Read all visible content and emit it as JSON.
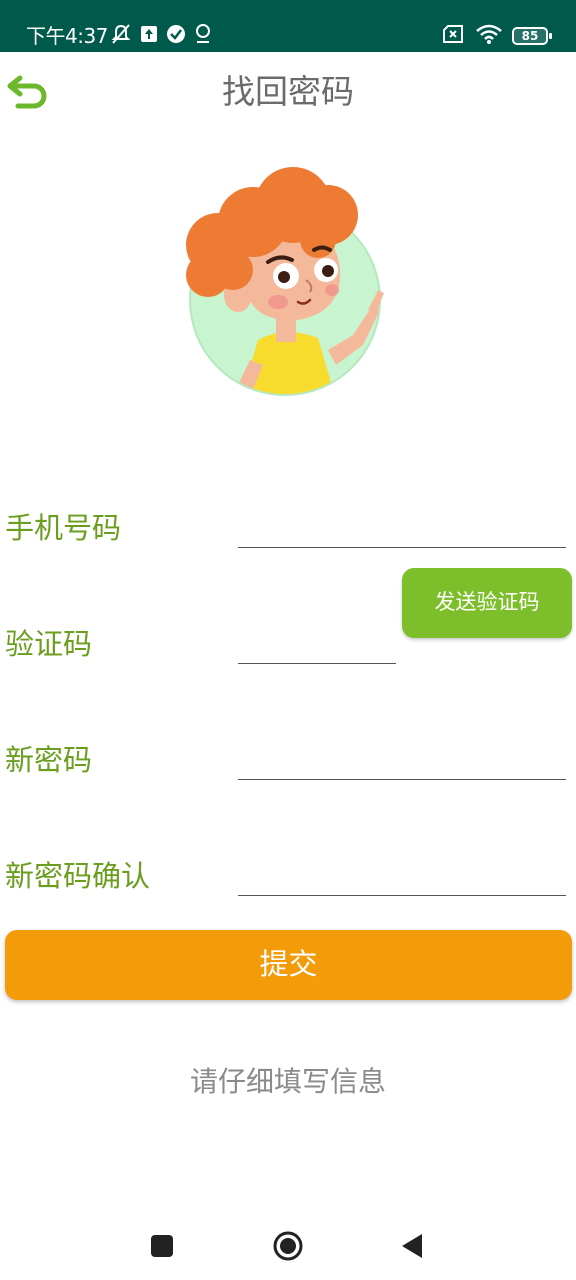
{
  "status_bar": {
    "time": "下午4:37",
    "left_icons": [
      "mute-bell-icon",
      "upload-icon",
      "check-circle-icon",
      "location-icon"
    ],
    "right_icons": [
      "no-sim-icon",
      "wifi-icon"
    ],
    "battery": "85"
  },
  "toolbar": {
    "title": "找回密码",
    "back_icon": "back-arrow-icon"
  },
  "form": {
    "phone_label": "手机号码",
    "phone_value": "",
    "code_label": "验证码",
    "code_value": "",
    "send_code_label": "发送验证码",
    "new_password_label": "新密码",
    "new_password_value": "",
    "confirm_password_label": "新密码确认",
    "confirm_password_value": ""
  },
  "submit_label": "提交",
  "hint": "请仔细填写信息",
  "colors": {
    "status_bar": "#005a4c",
    "label_green": "#6b9e1e",
    "send_button": "#7cbf2a",
    "submit_button": "#f49b0a"
  },
  "nav": {
    "recents_icon": "square-icon",
    "home_icon": "home-circle-icon",
    "back_icon": "triangle-back-icon"
  }
}
